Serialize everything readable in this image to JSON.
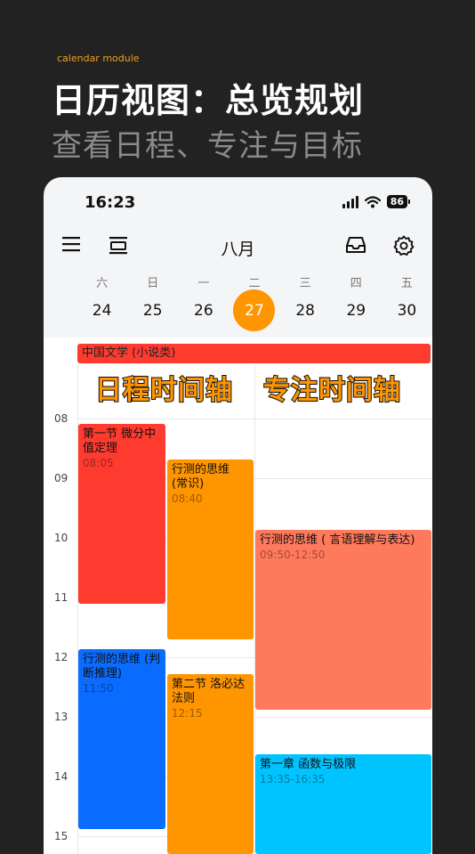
{
  "promo": {
    "tag": "calendar module",
    "title": "日历视图：总览规划",
    "subtitle": "查看日程、专注与目标"
  },
  "status_bar": {
    "time": "16:23",
    "battery": "86"
  },
  "toolbar": {
    "menu_icon": "menu-icon",
    "view_icon": "calendar-view-icon",
    "month": "八月",
    "inbox_icon": "inbox-icon",
    "settings_icon": "gear-icon"
  },
  "week": {
    "days": [
      {
        "weekday": "六",
        "date": "24"
      },
      {
        "weekday": "日",
        "date": "25"
      },
      {
        "weekday": "一",
        "date": "26"
      },
      {
        "weekday": "二",
        "date": "27",
        "today": true
      },
      {
        "weekday": "三",
        "date": "28"
      },
      {
        "weekday": "四",
        "date": "29"
      },
      {
        "weekday": "五",
        "date": "30"
      }
    ]
  },
  "all_day_event": {
    "title": "中国文学 (小说类)",
    "color": "#ff3b30"
  },
  "overlay_labels": {
    "left": "日程时间轴",
    "right": "专注时间轴"
  },
  "hours": [
    "08",
    "09",
    "10",
    "11",
    "12",
    "13",
    "14",
    "15"
  ],
  "events": [
    {
      "title": "第一节 微分中值定理",
      "time": "08:05",
      "color": "#ff3b30"
    },
    {
      "title": "行测的思维 (常识)",
      "time": "08:40",
      "color": "#ff9500"
    },
    {
      "title": "行测的思维 ( 言语理解与表达)",
      "time": "09:50-12:50",
      "color": "#ff7a5c"
    },
    {
      "title": "行测的思维 (判断推理)",
      "time": "11:50",
      "color": "#0a6cff"
    },
    {
      "title": "第二节 洛必达法则",
      "time": "12:15",
      "color": "#ff9500"
    },
    {
      "title": "第一章 函数与极限",
      "time": "13:35-16:35",
      "color": "#00c4ff"
    }
  ],
  "accent_color": "#ff9500"
}
